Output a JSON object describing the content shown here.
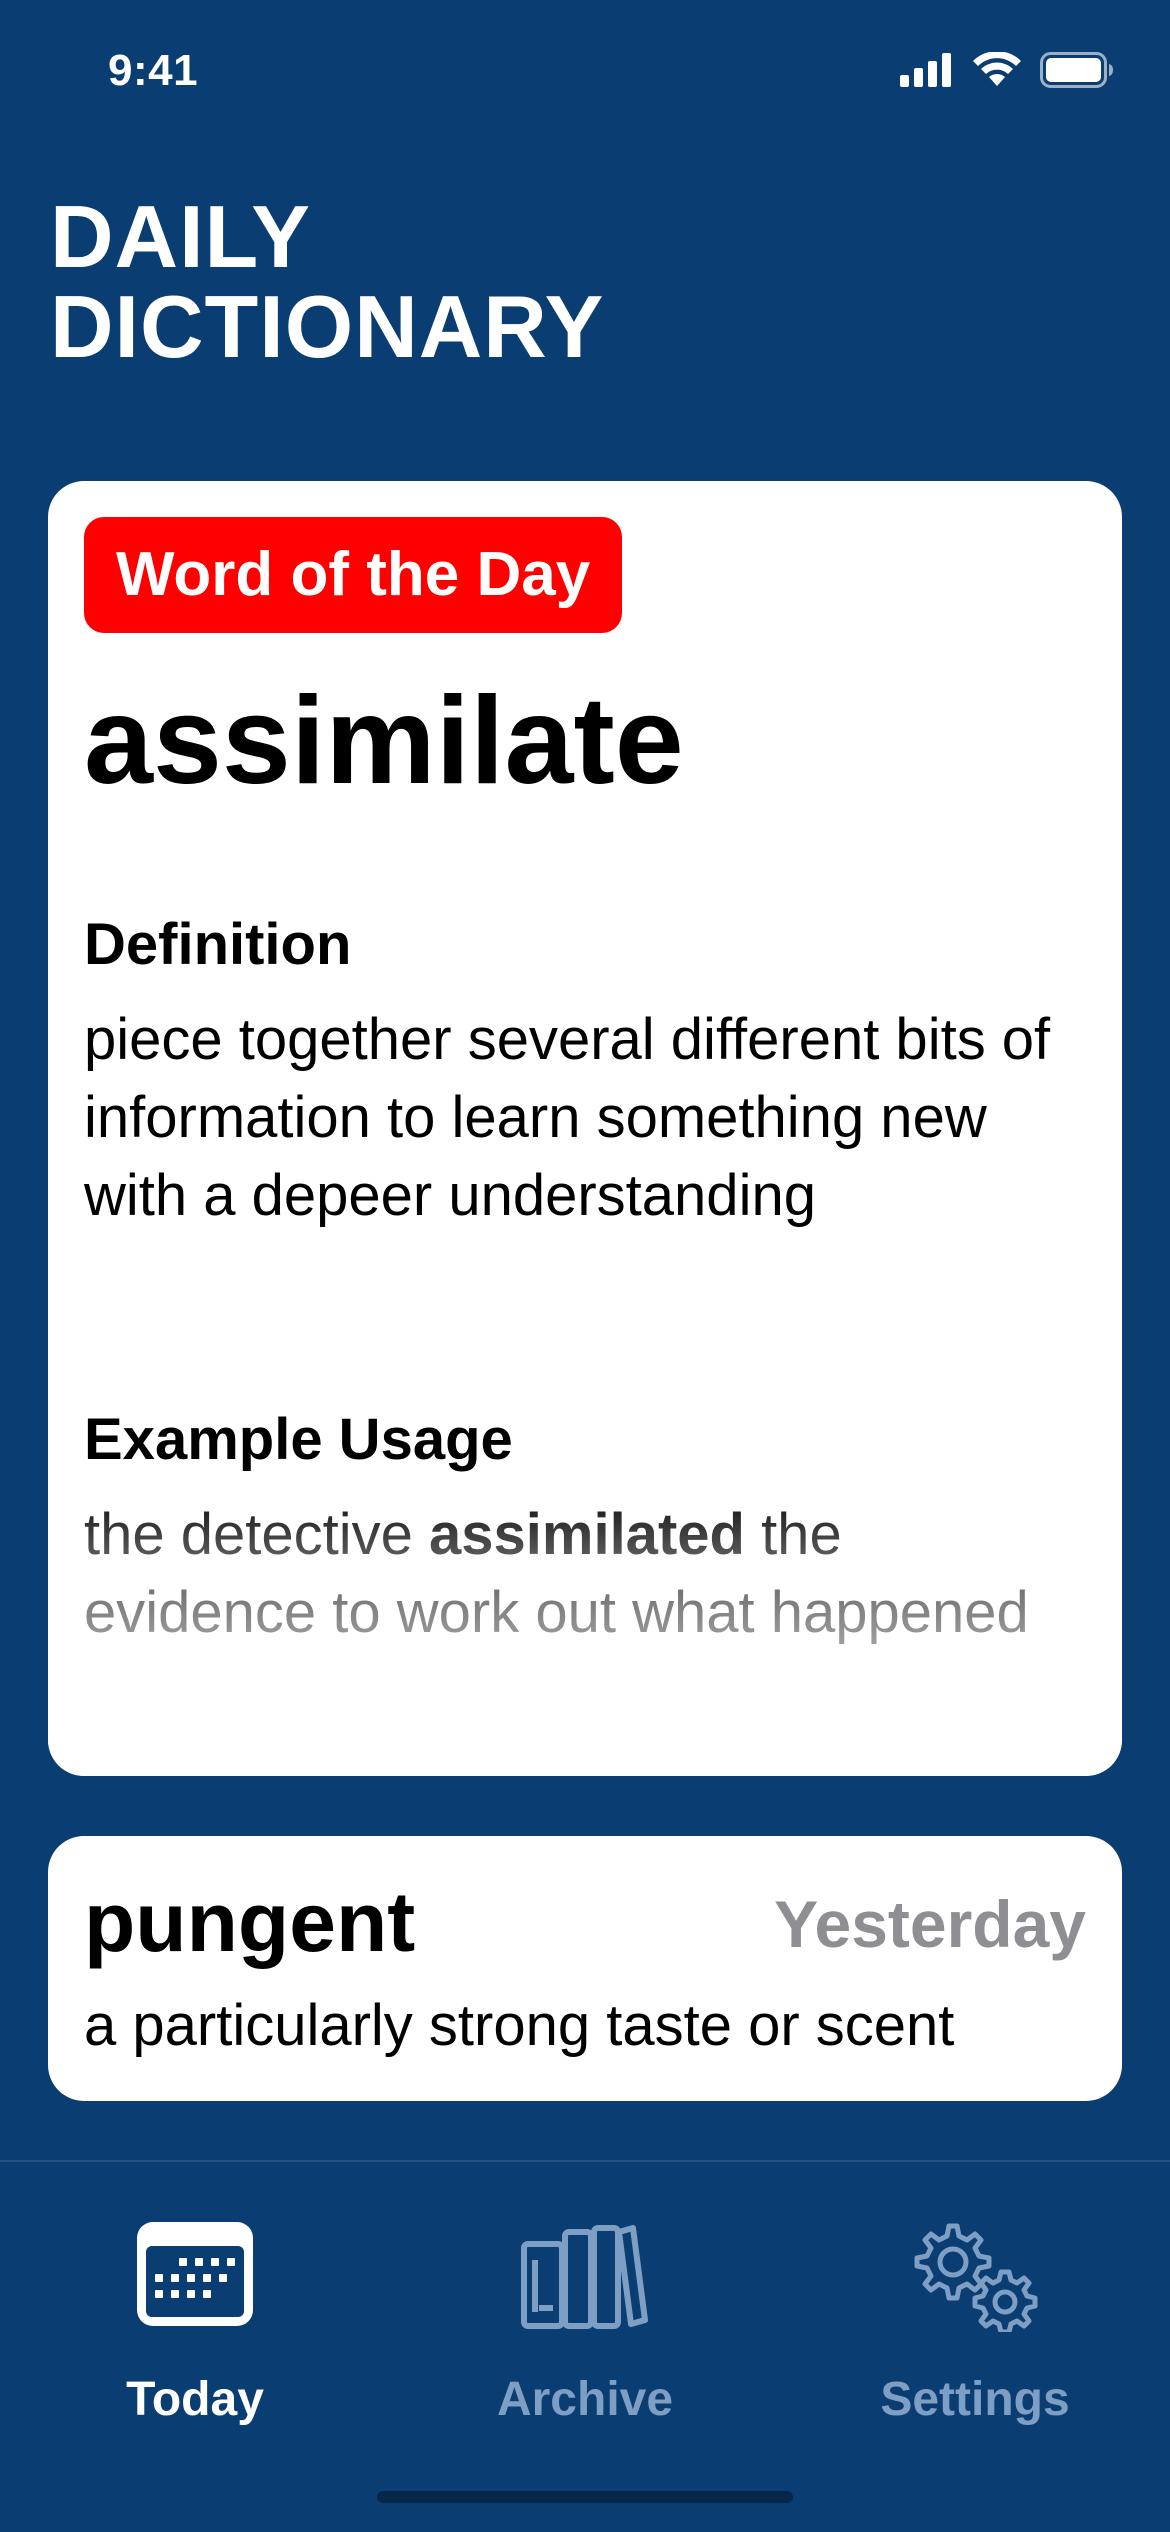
{
  "status_bar": {
    "time": "9:41",
    "icons": [
      "signal-icon",
      "wifi-icon",
      "battery-icon"
    ]
  },
  "header": {
    "title_line1": "DAILY",
    "title_line2": "DICTIONARY"
  },
  "word_of_day": {
    "badge": "Word of the Day",
    "word": "assimilate",
    "definition_label": "Definition",
    "definition": "piece together several different bits of information to learn something new with a depeer understanding",
    "example_label": "Example Usage",
    "example_before": "the detective ",
    "example_highlight": "assimilated",
    "example_after": " the evidence to work out what happened"
  },
  "previous_word": {
    "word": "pungent",
    "when": "Yesterday",
    "definition": "a particularly strong taste or scent"
  },
  "tabs": [
    {
      "label": "Today",
      "icon": "calendar-icon",
      "active": true
    },
    {
      "label": "Archive",
      "icon": "books-icon",
      "active": false
    },
    {
      "label": "Settings",
      "icon": "gears-icon",
      "active": false
    }
  ],
  "colors": {
    "background": "#0a3d72",
    "badge": "#ff0000",
    "inactive_tab": "#7f9ec4",
    "muted_text": "#8e8e93"
  }
}
